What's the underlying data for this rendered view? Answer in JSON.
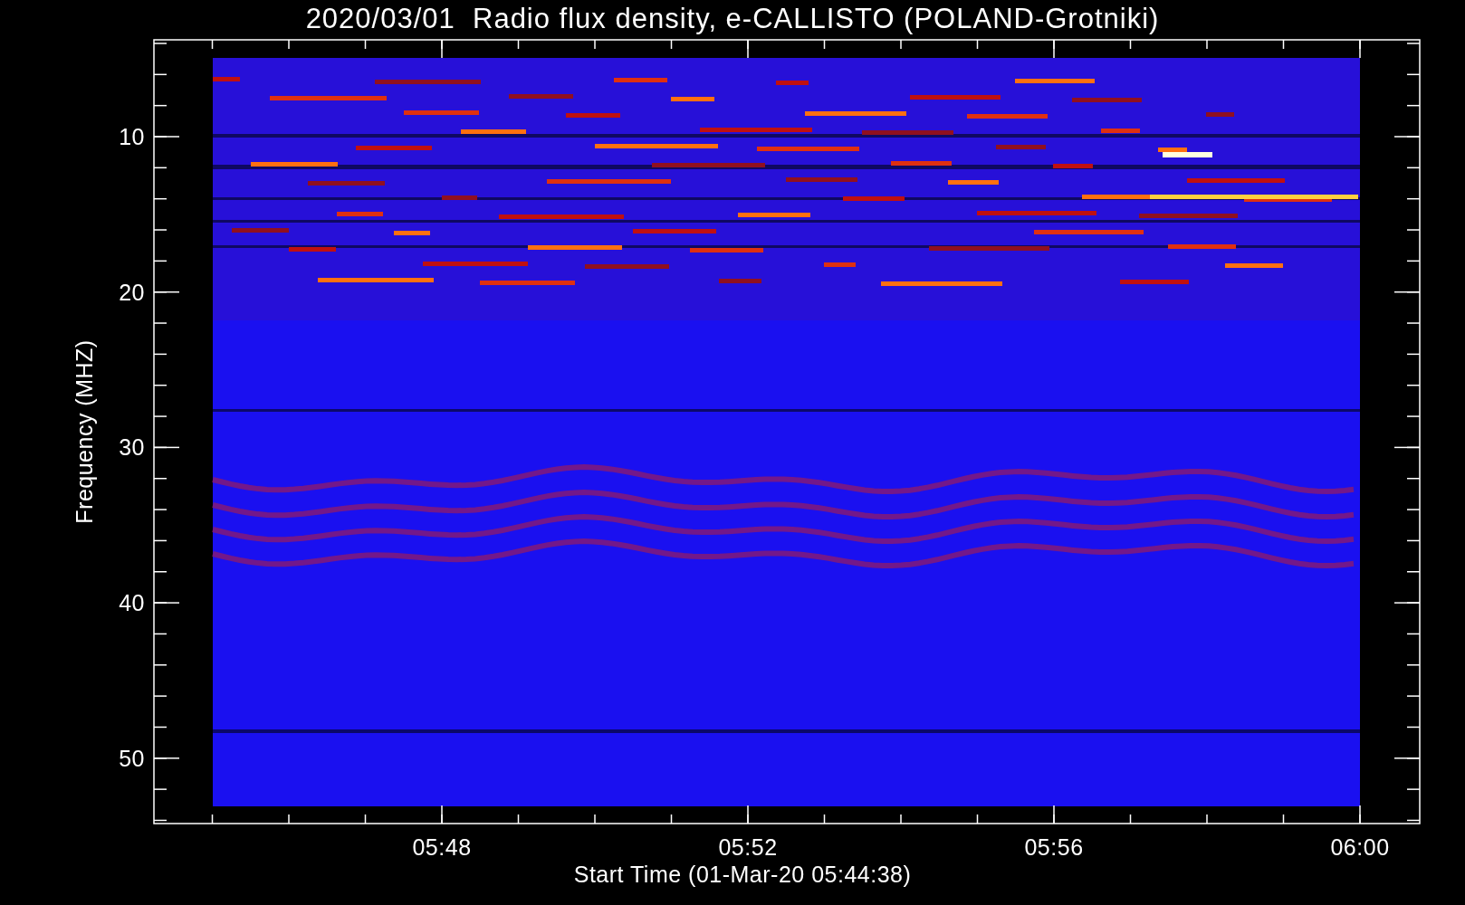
{
  "title": "2020/03/01  Radio flux density, e-CALLISTO (POLAND-Grotniki)",
  "y_axis": {
    "label": "Frequency (MHZ)",
    "ticks": [
      "10",
      "20",
      "30",
      "40",
      "50"
    ]
  },
  "x_axis": {
    "label": "Start Time (01-Mar-20 05:44:38)",
    "ticks": [
      "05:48",
      "05:52",
      "05:56",
      "06:00"
    ]
  }
}
